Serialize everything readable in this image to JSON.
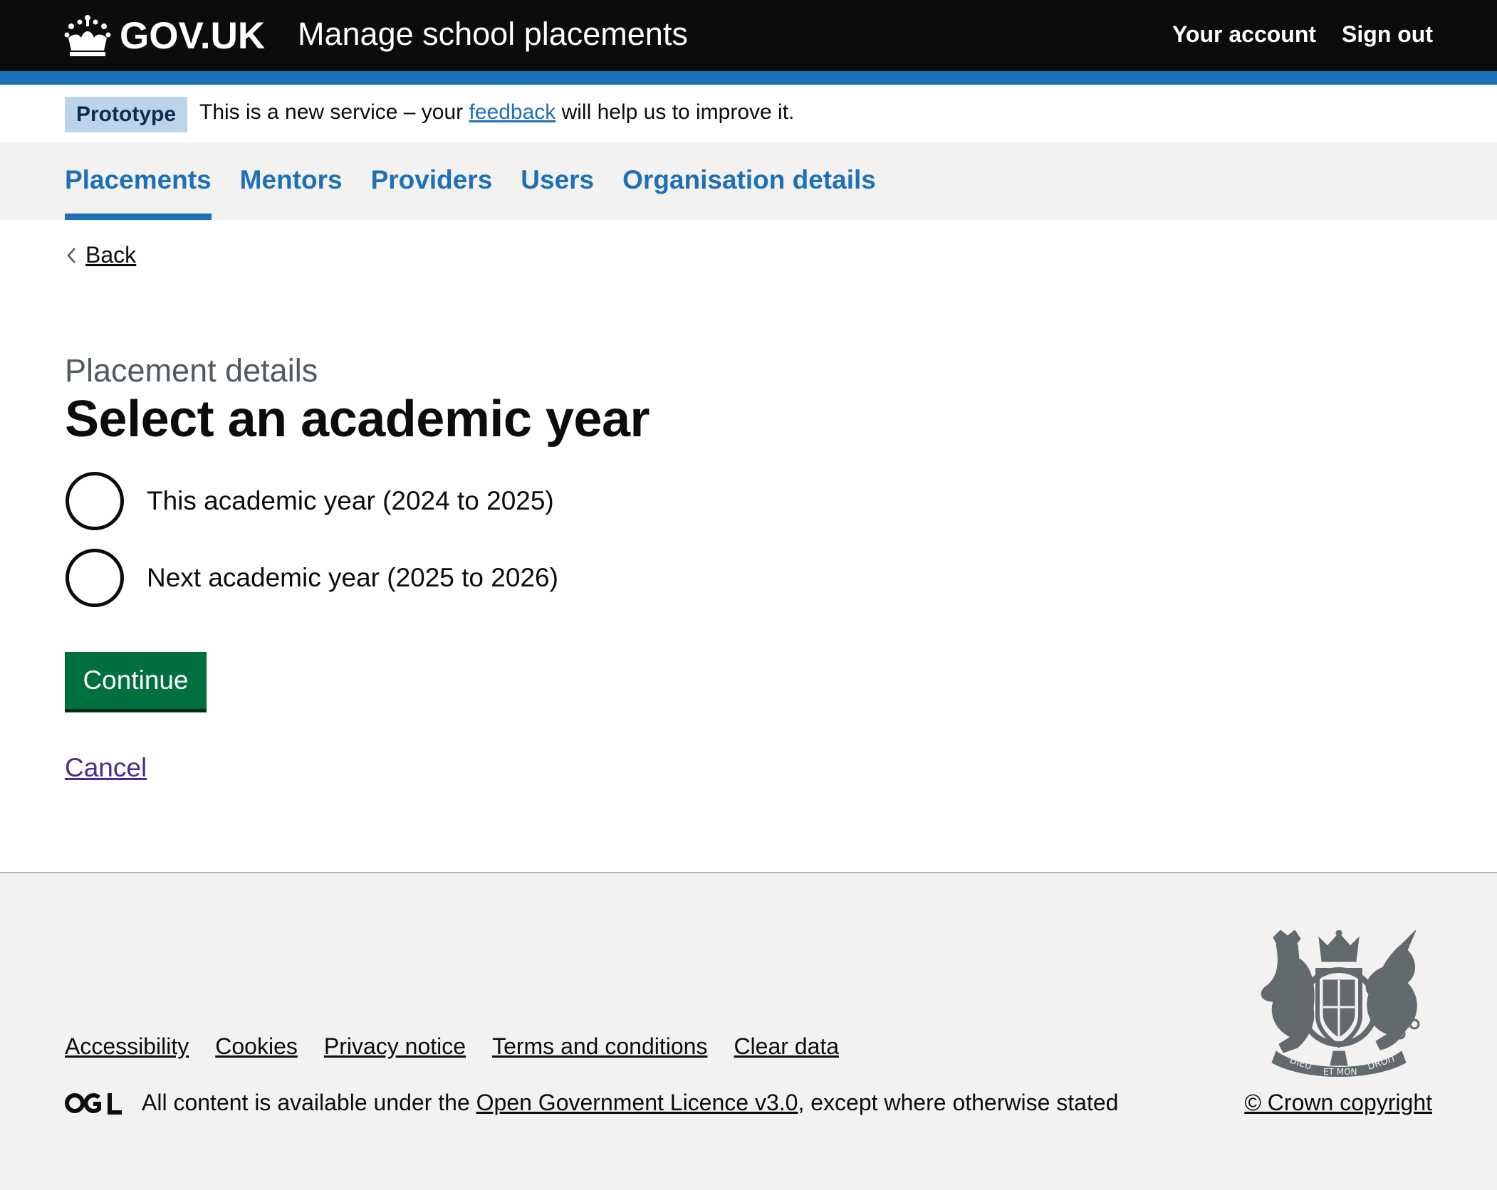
{
  "header": {
    "logo_text": "GOV.UK",
    "service_name": "Manage school placements",
    "nav": {
      "account": "Your account",
      "sign_out": "Sign out"
    }
  },
  "phase_banner": {
    "tag": "Prototype",
    "text_before": "This is a new service – your ",
    "link": "feedback",
    "text_after": " will help us to improve it."
  },
  "subnav": {
    "items": [
      {
        "label": "Placements",
        "active": true
      },
      {
        "label": "Mentors",
        "active": false
      },
      {
        "label": "Providers",
        "active": false
      },
      {
        "label": "Users",
        "active": false
      },
      {
        "label": "Organisation details",
        "active": false
      }
    ]
  },
  "back_link": "Back",
  "main": {
    "caption": "Placement details",
    "title": "Select an academic year",
    "options": [
      {
        "label": "This academic year (2024 to 2025)",
        "checked": false
      },
      {
        "label": "Next academic year (2025 to 2026)",
        "checked": false
      }
    ],
    "continue_label": "Continue",
    "cancel_label": "Cancel"
  },
  "footer": {
    "links": [
      "Accessibility",
      "Cookies",
      "Privacy notice",
      "Terms and conditions",
      "Clear data"
    ],
    "licence_before": "All content is available under the ",
    "licence_link": "Open Government Licence v3.0",
    "licence_after": ", except where otherwise stated",
    "copyright": "© Crown copyright",
    "crest_motto_1": "DIEU",
    "crest_motto_2": "ET MON",
    "crest_motto_3": "DROIT"
  },
  "colors": {
    "header_bg": "#0b0c0c",
    "brand_blue": "#1d70b8",
    "button_green": "#00703c",
    "visited_link": "#4c2c92",
    "footer_bg": "#f3f2f1"
  }
}
